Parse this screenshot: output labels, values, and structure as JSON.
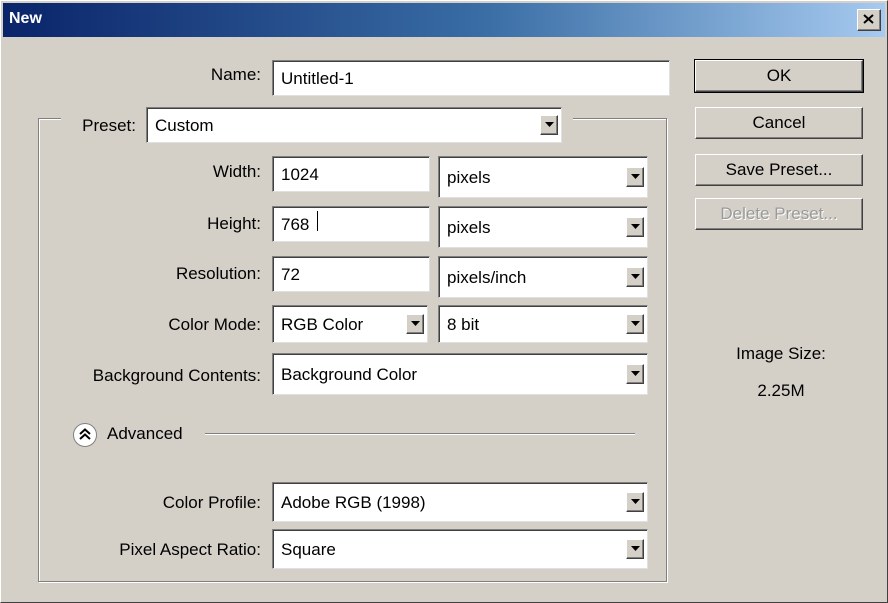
{
  "window": {
    "title": "New"
  },
  "form": {
    "name": {
      "label": "Name:",
      "value": "Untitled-1"
    },
    "preset": {
      "label": "Preset:",
      "value": "Custom"
    },
    "width": {
      "label": "Width:",
      "value": "1024",
      "unit": "pixels"
    },
    "height": {
      "label": "Height:",
      "value": "768",
      "unit": "pixels"
    },
    "resolution": {
      "label": "Resolution:",
      "value": "72",
      "unit": "pixels/inch"
    },
    "color_mode": {
      "label": "Color Mode:",
      "value": "RGB Color",
      "depth": "8 bit"
    },
    "background": {
      "label": "Background Contents:",
      "value": "Background Color"
    },
    "advanced": {
      "label": "Advanced"
    },
    "color_profile": {
      "label": "Color Profile:",
      "value": "Adobe RGB (1998)"
    },
    "pixel_aspect": {
      "label": "Pixel Aspect Ratio:",
      "value": "Square"
    }
  },
  "buttons": {
    "ok": "OK",
    "cancel": "Cancel",
    "save_preset": "Save Preset...",
    "delete_preset": "Delete Preset..."
  },
  "image_size": {
    "label": "Image Size:",
    "value": "2.25M"
  },
  "icons": {
    "close": "close-icon",
    "dropdown": "chevron-down-icon",
    "advanced_toggle": "double-chevron-up-icon"
  },
  "colors": {
    "title_bar_start": "#0a246a",
    "title_bar_end": "#a6caf0",
    "dialog_bg": "#d4d0c8"
  }
}
